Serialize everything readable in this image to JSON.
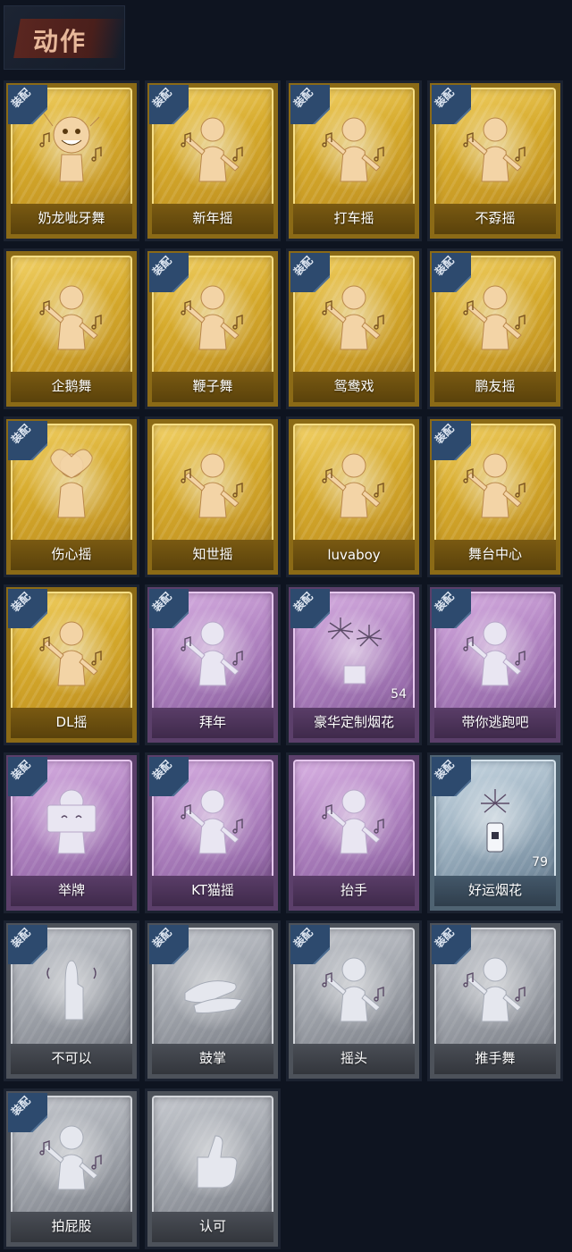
{
  "header": {
    "title": "动作"
  },
  "colors": {
    "gold": "#d6aa2c",
    "purple": "#b487c4",
    "blue": "#9fb3c2",
    "gray": "#a2a6ad",
    "badge": "#2d4a6e",
    "background": "#0e1420"
  },
  "badge_label": "装配",
  "actions": [
    {
      "label": "奶龙呲牙舞",
      "rarity": "gold",
      "equipped": true,
      "icon": "grinning-face-figure-icon"
    },
    {
      "label": "新年摇",
      "rarity": "gold",
      "equipped": true,
      "icon": "clapping-figure-icon"
    },
    {
      "label": "打车摇",
      "rarity": "gold",
      "equipped": true,
      "icon": "dancing-figure-icon"
    },
    {
      "label": "不孬摇",
      "rarity": "gold",
      "equipped": true,
      "icon": "arm-raised-figure-icon"
    },
    {
      "label": "企鹅舞",
      "rarity": "gold",
      "equipped": false,
      "icon": "dancing-figure-icon"
    },
    {
      "label": "鞭子舞",
      "rarity": "gold",
      "equipped": true,
      "icon": "heart-hand-figure-icon"
    },
    {
      "label": "鸳鸯戏",
      "rarity": "gold",
      "equipped": true,
      "icon": "dancing-figure-icon"
    },
    {
      "label": "鹏友摇",
      "rarity": "gold",
      "equipped": true,
      "icon": "crossed-arms-figure-icon"
    },
    {
      "label": "伤心摇",
      "rarity": "gold",
      "equipped": true,
      "icon": "heart-hands-figure-icon"
    },
    {
      "label": "知世摇",
      "rarity": "gold",
      "equipped": false,
      "icon": "dancing-figure-icon"
    },
    {
      "label": "luvaboy",
      "rarity": "gold",
      "equipped": false,
      "icon": "arms-crossed-figure-icon"
    },
    {
      "label": "舞台中心",
      "rarity": "gold",
      "equipped": true,
      "icon": "pose-figure-icon"
    },
    {
      "label": "DL摇",
      "rarity": "gold",
      "equipped": true,
      "icon": "arm-raised-figure-icon"
    },
    {
      "label": "拜年",
      "rarity": "purple",
      "equipped": true,
      "icon": "bowing-figure-icon"
    },
    {
      "label": "豪华定制烟花",
      "rarity": "purple",
      "equipped": true,
      "icon": "fireworks-box-icon",
      "count": "54"
    },
    {
      "label": "带你逃跑吧",
      "rarity": "purple",
      "equipped": true,
      "icon": "pointing-figure-icon"
    },
    {
      "label": "举牌",
      "rarity": "purple",
      "equipped": true,
      "icon": "sign-holding-figure-icon"
    },
    {
      "label": "KT猫摇",
      "rarity": "purple",
      "equipped": true,
      "icon": "dancing-figure-icon"
    },
    {
      "label": "抬手",
      "rarity": "purple",
      "equipped": false,
      "icon": "raising-hand-figure-icon"
    },
    {
      "label": "好运烟花",
      "rarity": "blue",
      "equipped": true,
      "icon": "firework-can-icon",
      "count": "79"
    },
    {
      "label": "不可以",
      "rarity": "gray",
      "equipped": true,
      "icon": "finger-wag-icon"
    },
    {
      "label": "鼓掌",
      "rarity": "gray",
      "equipped": true,
      "icon": "clapping-hands-icon"
    },
    {
      "label": "摇头",
      "rarity": "gray",
      "equipped": true,
      "icon": "head-shake-figure-icon"
    },
    {
      "label": "推手舞",
      "rarity": "gray",
      "equipped": true,
      "icon": "push-hands-figure-icon"
    },
    {
      "label": "拍屁股",
      "rarity": "gray",
      "equipped": true,
      "icon": "butt-slap-figure-icon"
    },
    {
      "label": "认可",
      "rarity": "gray",
      "equipped": false,
      "icon": "thumbs-up-icon"
    }
  ]
}
